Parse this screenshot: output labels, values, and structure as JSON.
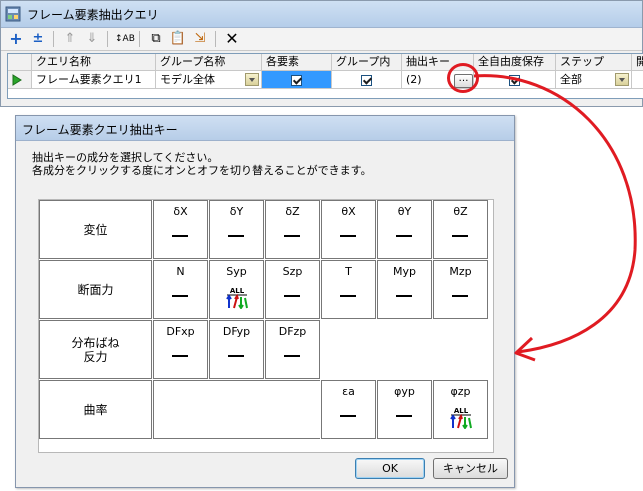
{
  "window": {
    "title": "フレーム要素抽出クエリ"
  },
  "toolbar": {
    "buttons": [
      "add-icon",
      "insert-icon",
      "move-up-icon",
      "move-down-icon",
      "sort-az-icon",
      "copy-icon",
      "paste-icon",
      "import-icon",
      "delete-icon"
    ]
  },
  "grid": {
    "columns": [
      "クエリ名称",
      "グループ名称",
      "各要素",
      "グループ内",
      "抽出キー",
      "全自由度保存",
      "ステップ",
      "開"
    ],
    "row": {
      "name": "フレーム要素クエリ1",
      "group": "モデル全体",
      "per_element": true,
      "in_group": true,
      "key_value": "(2)",
      "key_button": "…",
      "save_all_dof": true,
      "step": "全部"
    }
  },
  "dialog": {
    "title": "フレーム要素クエリ抽出キー",
    "instruction_line1": "抽出キーの成分を選択してください。",
    "instruction_line2": "各成分をクリックする度にオンとオフを切り替えることができます。",
    "categories": {
      "displacement": "変位",
      "section_force": "断面力",
      "spring_force": "分布ばね\n反力",
      "curvature": "曲率"
    },
    "displacement_keys": [
      "δX",
      "δY",
      "δZ",
      "θX",
      "θY",
      "θZ"
    ],
    "section_force_keys": [
      "N",
      "Syp",
      "Szp",
      "T",
      "Myp",
      "Mzp"
    ],
    "spring_keys": [
      "DFxp",
      "DFyp",
      "DFzp"
    ],
    "curvature_keys": [
      "εa",
      "φyp",
      "φzp"
    ],
    "dash": "—",
    "all_icon_text": "ALL",
    "ok_label": "OK",
    "cancel_label": "キャンセル"
  },
  "colors": {
    "highlight_circle": "#e01b22",
    "arrow": "#e01b22",
    "selected_cell": "#3399ff"
  }
}
